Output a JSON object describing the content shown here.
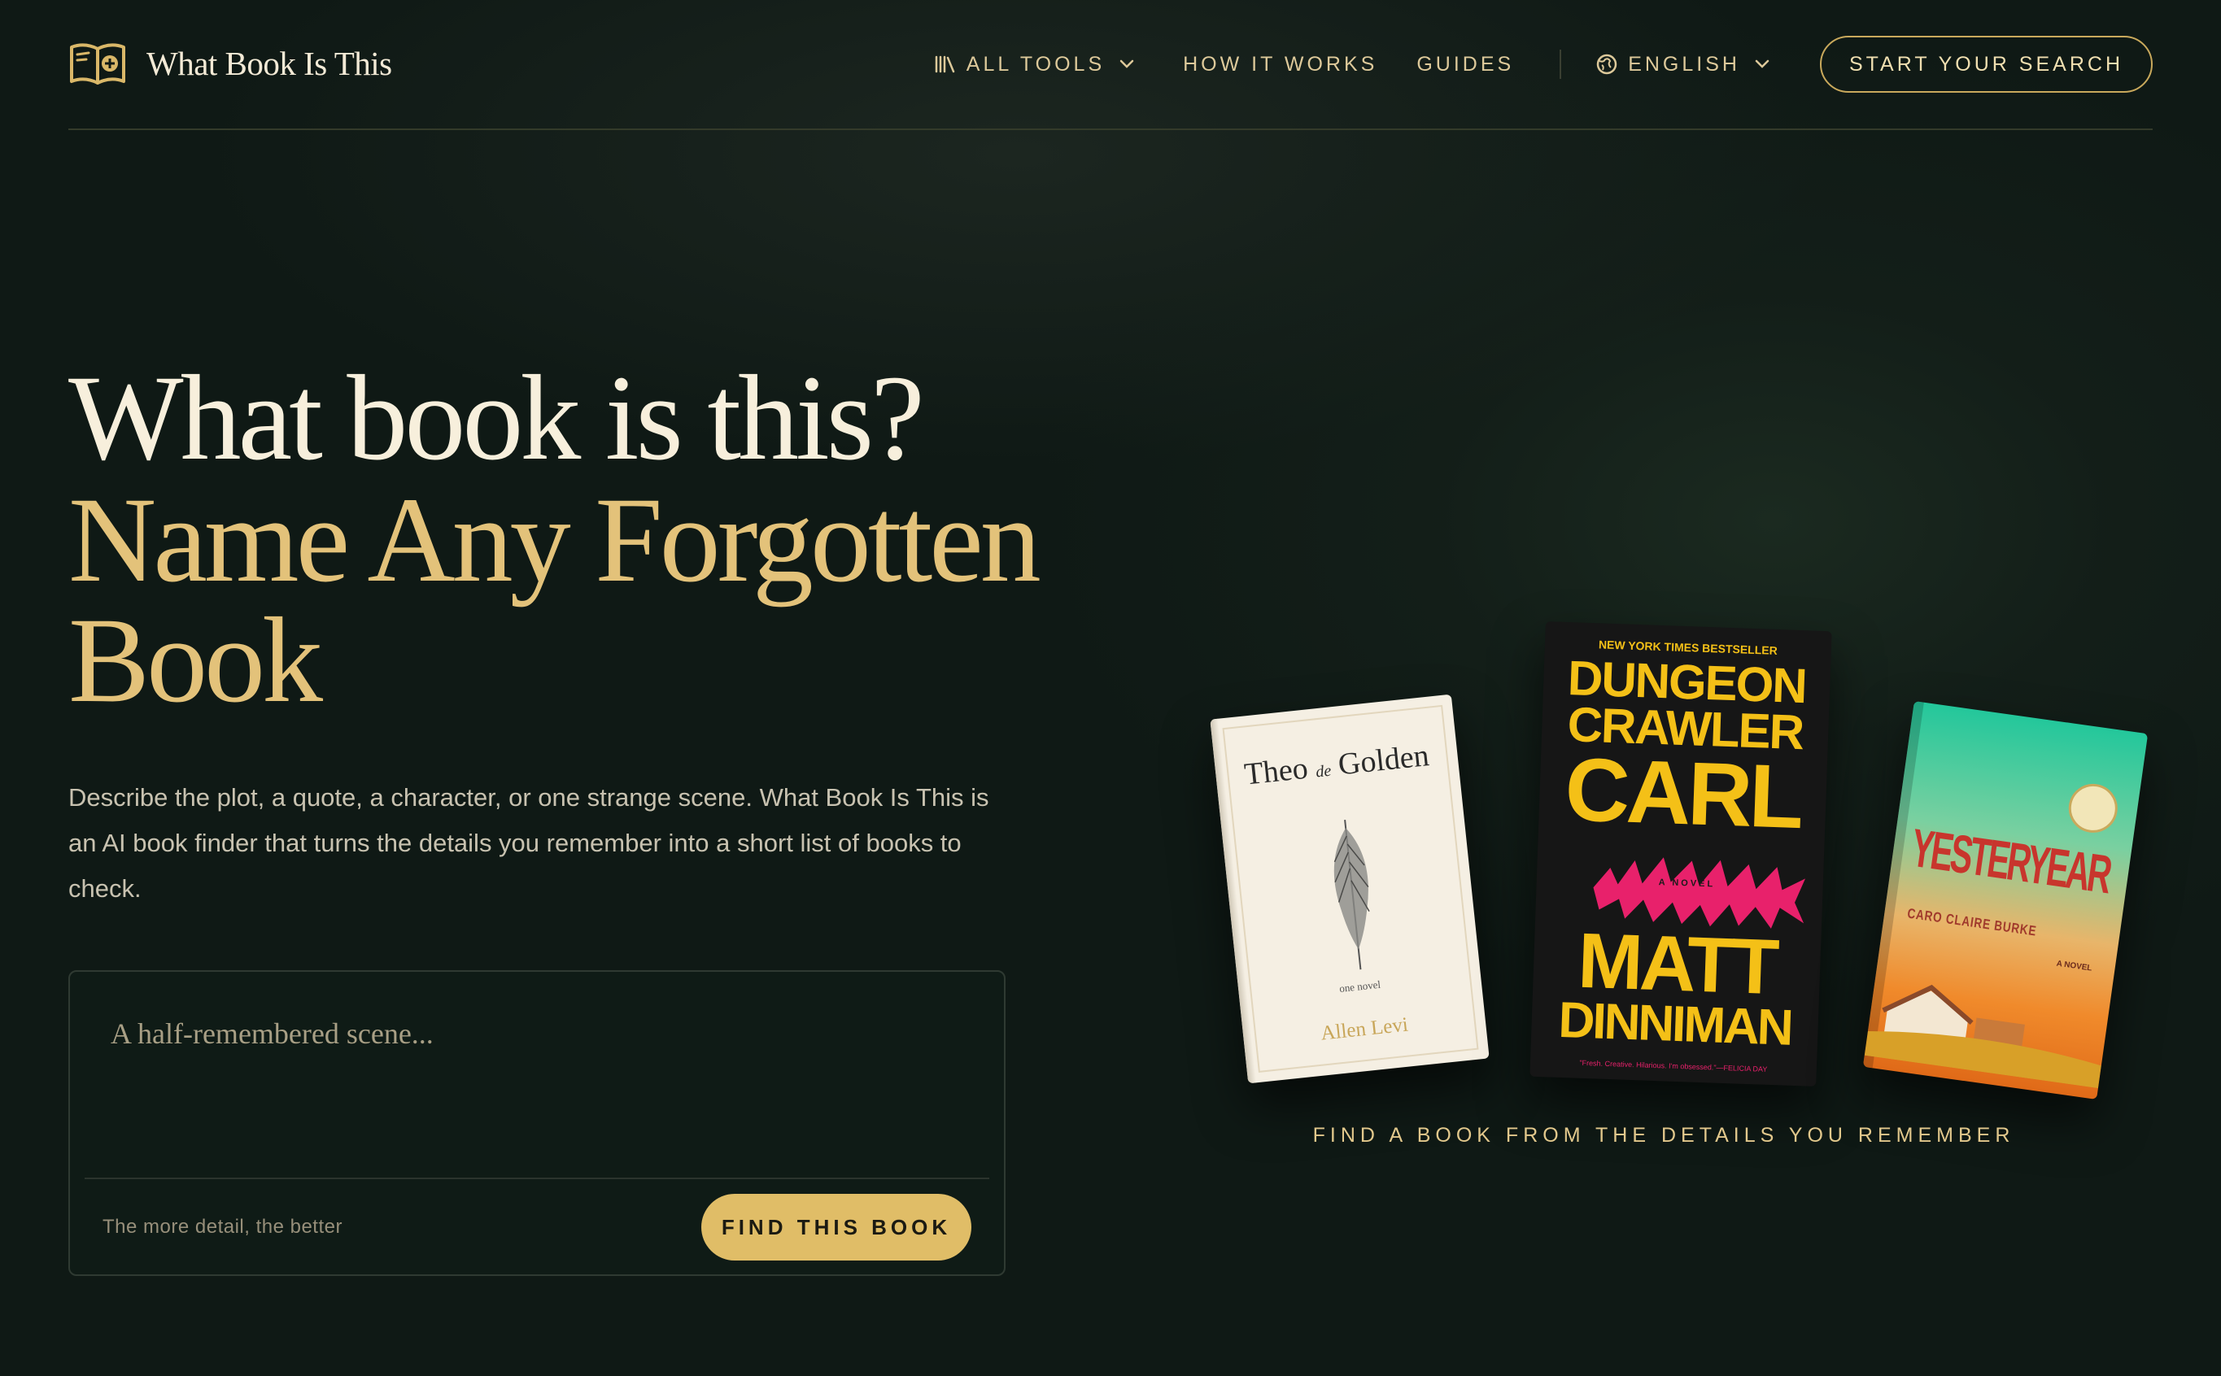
{
  "header": {
    "brand": "What Book Is This",
    "nav": {
      "all_tools": "All Tools",
      "how_it_works": "How It Works",
      "guides": "Guides",
      "language": "English"
    },
    "cta": "Start Your Search"
  },
  "hero": {
    "title_line1": "What book is this?",
    "title_line2": "Name Any Forgotten Book",
    "description": "Describe the plot, a quote, a character, or one strange scene. What Book Is This is an AI book finder that turns the details you remember into a short list of books to check.",
    "search": {
      "placeholder": "A half-remembered scene...",
      "hint": "The more detail, the better",
      "button": "Find This Book"
    }
  },
  "books": {
    "caption": "Find a book from the details you remember",
    "theo": {
      "title_a": "Theo",
      "title_b": "de",
      "title_c": "Golden",
      "subtitle": "one novel",
      "author": "Allen Levi"
    },
    "carl": {
      "banner": "NEW YORK TIMES BESTSELLER",
      "title_1": "DUNGEON",
      "title_2": "CRAWLER",
      "title_3": "CARL",
      "author_1": "MATT",
      "author_2": "DINNIMAN",
      "tag": "A NOVEL",
      "quote": "\"Fresh. Creative. Hilarious. I'm obsessed.\"—FELICIA DAY"
    },
    "yesteryear": {
      "title": "YESTERYEAR",
      "author": "CARO CLAIRE BURKE",
      "tag": "A NOVEL"
    }
  },
  "colors": {
    "background": "#0f1915",
    "accent_gold": "#e0bd67",
    "headline_cream": "#f7efdc"
  }
}
